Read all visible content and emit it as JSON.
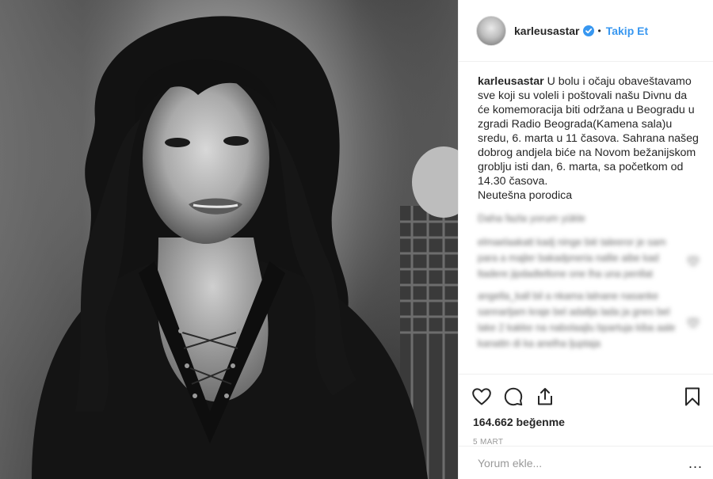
{
  "header": {
    "username": "karleusastar",
    "separator": "•",
    "follow_label": "Takip Et"
  },
  "caption": {
    "username": "karleusastar",
    "text": "U bolu i očaju obaveštavamo sve koji su voleli i poštovali našu Divnu da će komemoracija biti održana u Beogradu u zgradi Radio Beograda(Kamena sala)u sredu, 6. marta u 11 časova. Sahrana našeg dobrog andjela biće na Novom bežanijskom groblju isti dan, 6. marta, sa početkom od 14.30 časova.",
    "signature": "Neutešna porodica"
  },
  "comments": {
    "load_more": "Daha fazla yorum yükle",
    "items": [
      "elmaelaakatt kadj ninge bié taleeror je sam para a majler bakadpneria nallie aibe kad ltadere jipdadtellone one lha una penllat",
      "angella_kall bil a nkama lalnane nasanke sannarljam kraje bel adallja lada ja gnes bel lake 2 kakke na nabolaajlu bpartuja kiba aale kanattn di ka anelha ljuptaja"
    ]
  },
  "actions": {
    "icons": [
      "heart-icon",
      "comment-icon",
      "share-icon",
      "bookmark-icon"
    ],
    "likes": "164.662 beğenme",
    "date": "5 MART"
  },
  "add_comment": {
    "placeholder": "Yorum ekle...",
    "more": "..."
  },
  "colors": {
    "accent": "#3897f0",
    "text": "#262626",
    "muted": "#999999",
    "border": "#efefef"
  }
}
